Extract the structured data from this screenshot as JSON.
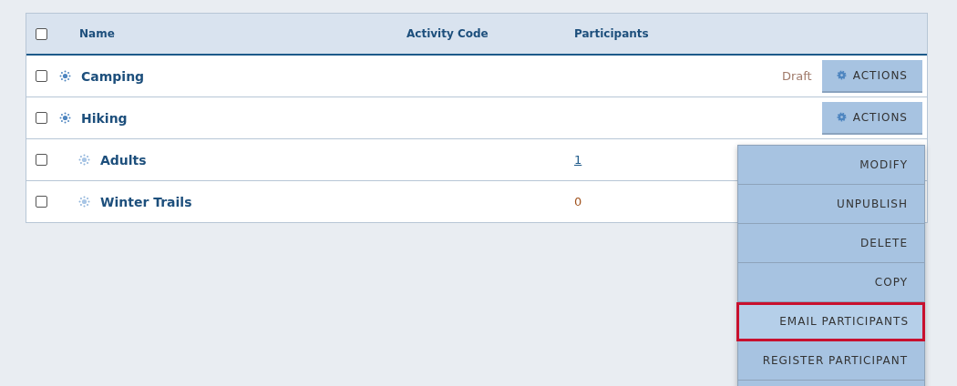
{
  "table": {
    "select_all": {
      "checked": false
    },
    "columns": [
      "Name",
      "Activity Code",
      "Participants"
    ],
    "rows": [
      {
        "name": "Camping",
        "checked": false,
        "status": "Draft",
        "action": "ACTIONS"
      },
      {
        "name": "Hiking",
        "checked": false,
        "action": "ACTIONS",
        "children": [
          {
            "name": "Adults",
            "checked": false,
            "participants": {
              "text": "1",
              "kind": "link"
            }
          },
          {
            "name": "Winter Trails",
            "checked": false,
            "participants": {
              "text": "0",
              "kind": "plain"
            }
          }
        ]
      }
    ]
  },
  "actions_menu": {
    "items": [
      {
        "label": "MODIFY",
        "selected": false
      },
      {
        "label": "UNPUBLISH",
        "selected": false
      },
      {
        "label": "DELETE",
        "selected": false
      },
      {
        "label": "COPY",
        "selected": false
      },
      {
        "label": "EMAIL PARTICIPANTS",
        "selected": true
      },
      {
        "label": "REGISTER PARTICIPANT",
        "selected": false
      },
      {
        "selected": false
      }
    ]
  }
}
